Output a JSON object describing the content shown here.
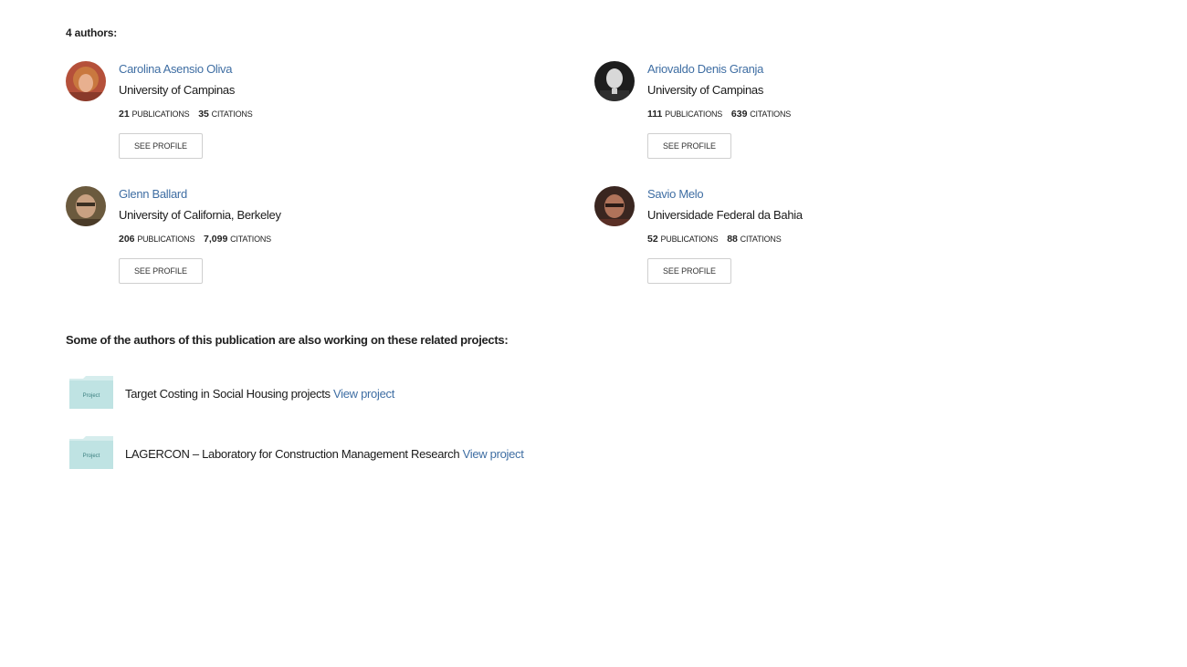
{
  "authors_heading": "4 authors:",
  "authors": [
    {
      "name": "Carolina Asensio Oliva",
      "institution": "University of Campinas",
      "publications": "21",
      "publications_label": "PUBLICATIONS",
      "citations": "35",
      "citations_label": "CITATIONS",
      "button": "SEE PROFILE"
    },
    {
      "name": "Ariovaldo Denis Granja",
      "institution": "University of Campinas",
      "publications": "111",
      "publications_label": "PUBLICATIONS",
      "citations": "639",
      "citations_label": "CITATIONS",
      "button": "SEE PROFILE"
    },
    {
      "name": "Glenn Ballard",
      "institution": "University of California, Berkeley",
      "publications": "206",
      "publications_label": "PUBLICATIONS",
      "citations": "7,099",
      "citations_label": "CITATIONS",
      "button": "SEE PROFILE"
    },
    {
      "name": "Savio Melo",
      "institution": "Universidade Federal da Bahia",
      "publications": "52",
      "publications_label": "PUBLICATIONS",
      "citations": "88",
      "citations_label": "CITATIONS",
      "button": "SEE PROFILE"
    }
  ],
  "projects_heading": "Some of the authors of this publication are also working on these related projects:",
  "projects": [
    {
      "title": "Target Costing in Social Housing projects",
      "link": "View project",
      "icon_label": "Project",
      "icon": "project-folder-icon"
    },
    {
      "title": "LAGERCON – Laboratory for Construction Management Research",
      "link": "View project",
      "icon_label": "Project",
      "icon": "project-folder-icon"
    }
  ],
  "colors": {
    "link": "#3f6ea3",
    "text": "#1a1a1a",
    "folder": "#bfe3e3",
    "folder_tab": "#d6eded"
  }
}
